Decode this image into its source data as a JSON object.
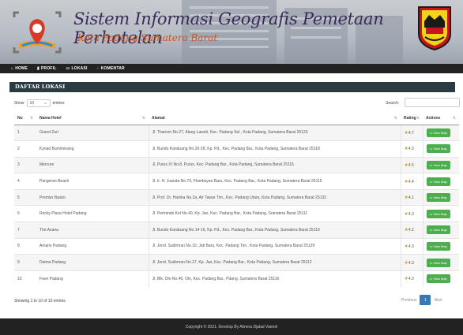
{
  "header": {
    "title": "Sistem Informasi Geografis Pemetaan Perhotelan",
    "subtitle": "Kota Padang Sumatera Barat"
  },
  "nav": [
    {
      "label": "HOME",
      "icon": "home-icon"
    },
    {
      "label": "PROFIL",
      "icon": "profile-icon"
    },
    {
      "label": "LOKASI",
      "icon": "map-icon"
    },
    {
      "label": "KOMENTAR",
      "icon": "comment-icon"
    }
  ],
  "panel": {
    "title": "DAFTAR LOKASI",
    "show_label": "Show",
    "show_value": "10",
    "entries_label": "entries",
    "search_label": "Search:",
    "search_value": ""
  },
  "table": {
    "columns": [
      "No",
      "Nama Hotel",
      "Alamat",
      "Rating",
      "Actions"
    ],
    "rows": [
      {
        "no": "1",
        "name": "Grand Zuri",
        "alamat": "Jl. Thamrin No.27, Alang Laweh, Kec. Padang Sel., Kota Padang, Sumatera Barat 25133",
        "rating": "4.7"
      },
      {
        "no": "2",
        "name": "Kyriad Bumiminang",
        "alamat": "Jl. Bundo Kanduang No.20-28, Kp. Pd., Kec. Padang Bar., Kota Padang, Sumatera Barat 25118",
        "rating": "4.3"
      },
      {
        "no": "3",
        "name": "Mercure",
        "alamat": "Jl. Purus IV No.8, Purus, Kec. Padang Bar., Kota Padang, Sumatera Barat 25115",
        "rating": "4.5"
      },
      {
        "no": "4",
        "name": "Pangeran Beach",
        "alamat": "Jl. Ir. H. Juanda No.79, Flamboyan Baru, Kec. Padang Bar., Kota Padang, Sumatera Barat 25115",
        "rating": "4.4"
      },
      {
        "no": "5",
        "name": "Premier Basko",
        "alamat": "Jl. Prof. Dr. Hamka No.2a, Air Tawar Tim., Kec. Padang Utara, Kota Padang, Sumatera Barat 25132",
        "rating": "4.1"
      },
      {
        "no": "6",
        "name": "Rocky Plaza Hotel Padang",
        "alamat": "Jl. Permindo Kel No.40, Kp. Jao, Kec. Padang Bar., Kota Padang, Sumatera Barat 25111",
        "rating": "4.3"
      },
      {
        "no": "7",
        "name": "The Axana",
        "alamat": "Jl. Bundo Kanduang No.14-16, Kp. Pd., Kec. Padang Bar., Kota Padang, Sumatera Barat 25119",
        "rating": "4.2"
      },
      {
        "no": "8",
        "name": "Amaris Padang",
        "alamat": "Jl. Jend. Sudirman No.19, Jati Baru, Kec. Padang Tim., Kota Padang, Sumatera Barat 25129",
        "rating": "4.3"
      },
      {
        "no": "9",
        "name": "Daima Padang",
        "alamat": "Jl. Jend. Sudirman No.17, Kp. Jao, Kec. Padang Bar., Kota Padang, Sumatera Barat 25112",
        "rating": "4.3"
      },
      {
        "no": "10",
        "name": "Fave Padang",
        "alamat": "Jl. Blk. Olo No.46, Olo, Kec. Padang Bar., Pdang, Sumatera Barat 25116",
        "rating": "4.0"
      }
    ],
    "action_label": "View Map"
  },
  "pagination": {
    "info": "Showing 1 to 10 of 10 entries",
    "previous": "Previous",
    "current": "1",
    "next": "Next"
  },
  "footer": {
    "text": "Copyright © 2021. Develop By Almera Djabal Vaenel"
  },
  "colors": {
    "nav_bg": "#222222",
    "panel_head_bg": "#2a3b42",
    "button_green": "#4cae4c",
    "page_active": "#337ab7",
    "star": "#d9a01c"
  }
}
